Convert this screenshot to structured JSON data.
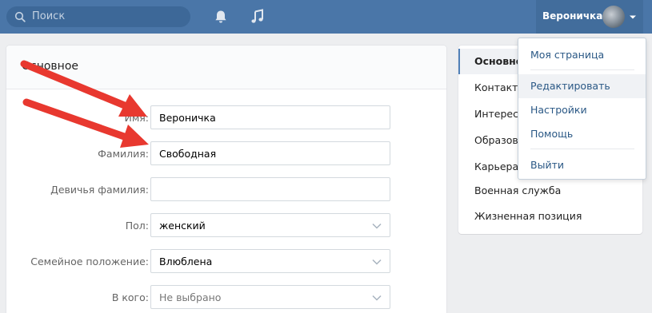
{
  "header": {
    "search_placeholder": "Поиск",
    "user_name": "Вероничка",
    "bg_color": "#4a76a8"
  },
  "form": {
    "section_title": "Основное",
    "fields": [
      {
        "label": "Имя:",
        "value": "Вероничка",
        "type": "text"
      },
      {
        "label": "Фамилия:",
        "value": "Свободная",
        "type": "text"
      },
      {
        "label": "Девичья фамилия:",
        "value": "",
        "type": "text"
      },
      {
        "label": "Пол:",
        "value": "женский",
        "type": "select"
      },
      {
        "label": "Семейное положение:",
        "value": "Влюблена",
        "type": "select"
      },
      {
        "label": "В кого:",
        "value": "Не выбрано",
        "type": "select"
      }
    ]
  },
  "sidebar": {
    "items": [
      {
        "label": "Основное",
        "active": true
      },
      {
        "label": "Контакты"
      },
      {
        "label": "Интересы"
      },
      {
        "label": "Образование"
      },
      {
        "label": "Карьера"
      },
      {
        "label": "Военная служба"
      },
      {
        "label": "Жизненная позиция"
      }
    ]
  },
  "dropdown": {
    "items": [
      {
        "label": "Моя страница"
      },
      {
        "label": "Редактировать",
        "hover": true
      },
      {
        "label": "Настройки"
      },
      {
        "label": "Помощь"
      },
      {
        "label": "Выйти"
      }
    ]
  },
  "colors": {
    "accent": "#5181b8",
    "link": "#2a5885",
    "arrow": "#e8382f"
  }
}
